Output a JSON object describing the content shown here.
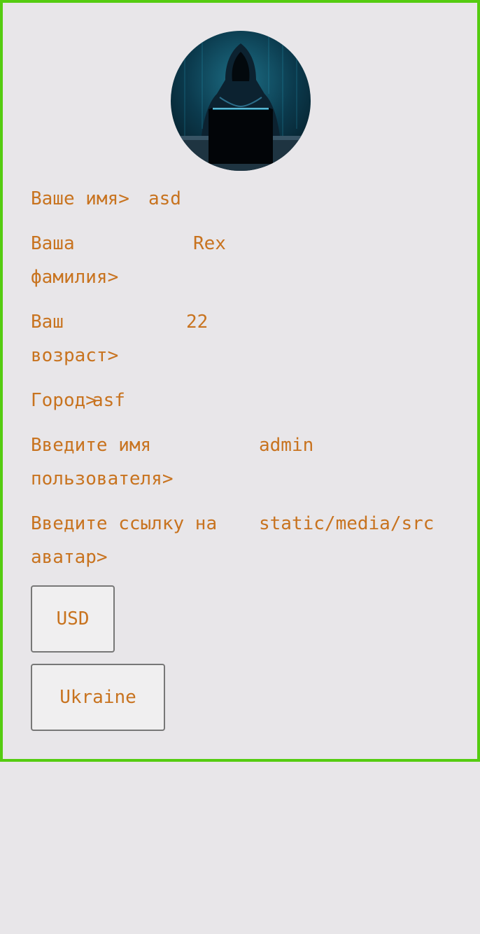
{
  "colors": {
    "frame_border": "#55cc11",
    "background": "#e8e6e9",
    "text": "#c8731f",
    "button_background": "#f0eff0",
    "button_border": "#777777"
  },
  "avatar": {
    "icon": "hooded-hacker-avatar",
    "alt": "avatar"
  },
  "fields": {
    "first_name": {
      "label_line1": "Ваше имя>",
      "value": "asd"
    },
    "last_name": {
      "label_line1": "Ваша",
      "label_line2": "фамилия>",
      "value": "Rex"
    },
    "age": {
      "label_line1": "Ваш",
      "label_line2": "возраст>",
      "value": "22"
    },
    "city": {
      "label_line1": "Город>",
      "value": "asf"
    },
    "username": {
      "label_line1": "Введите имя",
      "label_line2": "пользователя>",
      "value": "admin"
    },
    "avatar_link": {
      "label_line1": "Введите ссылку на",
      "label_line2": "аватар>",
      "value": "static/media/src"
    }
  },
  "buttons": {
    "currency": "USD",
    "country": "Ukraine"
  }
}
